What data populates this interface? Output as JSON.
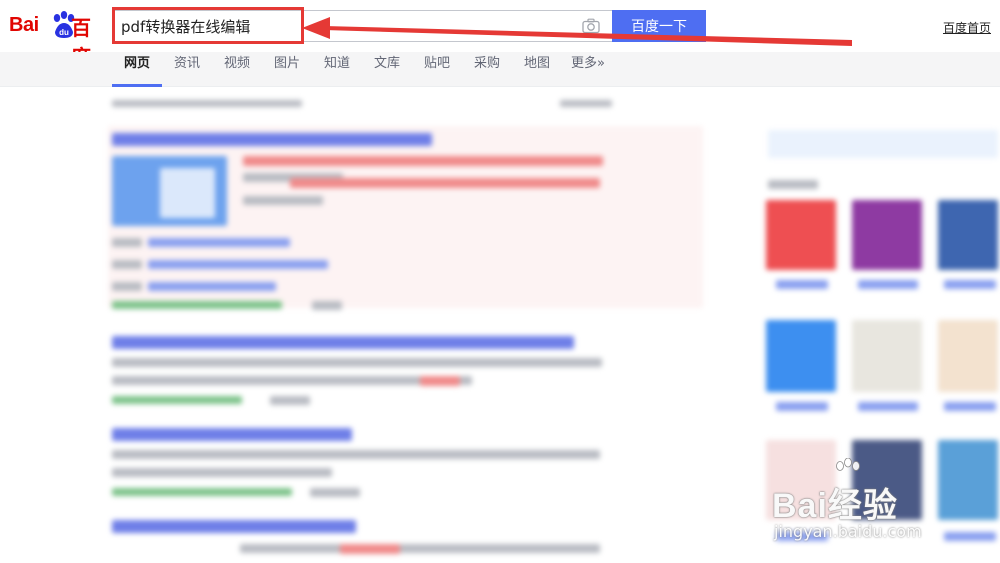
{
  "header": {
    "logo_text_bai": "Bai",
    "logo_text_zh": "百度",
    "search_value": "pdf转换器在线编辑",
    "search_button_label": "百度一下",
    "home_link_label": "百度首页",
    "camera_icon": "camera-icon",
    "accent_color": "#4e6ef2",
    "annotation_color": "#e53935"
  },
  "tabs": [
    {
      "label": "网页",
      "active": true
    },
    {
      "label": "资讯"
    },
    {
      "label": "视频"
    },
    {
      "label": "图片"
    },
    {
      "label": "知道"
    },
    {
      "label": "文库"
    },
    {
      "label": "贴吧"
    },
    {
      "label": "采购"
    },
    {
      "label": "地图"
    },
    {
      "label": "更多»"
    }
  ],
  "watermark": {
    "text": "Bai经验",
    "url": "jingyan.baidu.com"
  }
}
